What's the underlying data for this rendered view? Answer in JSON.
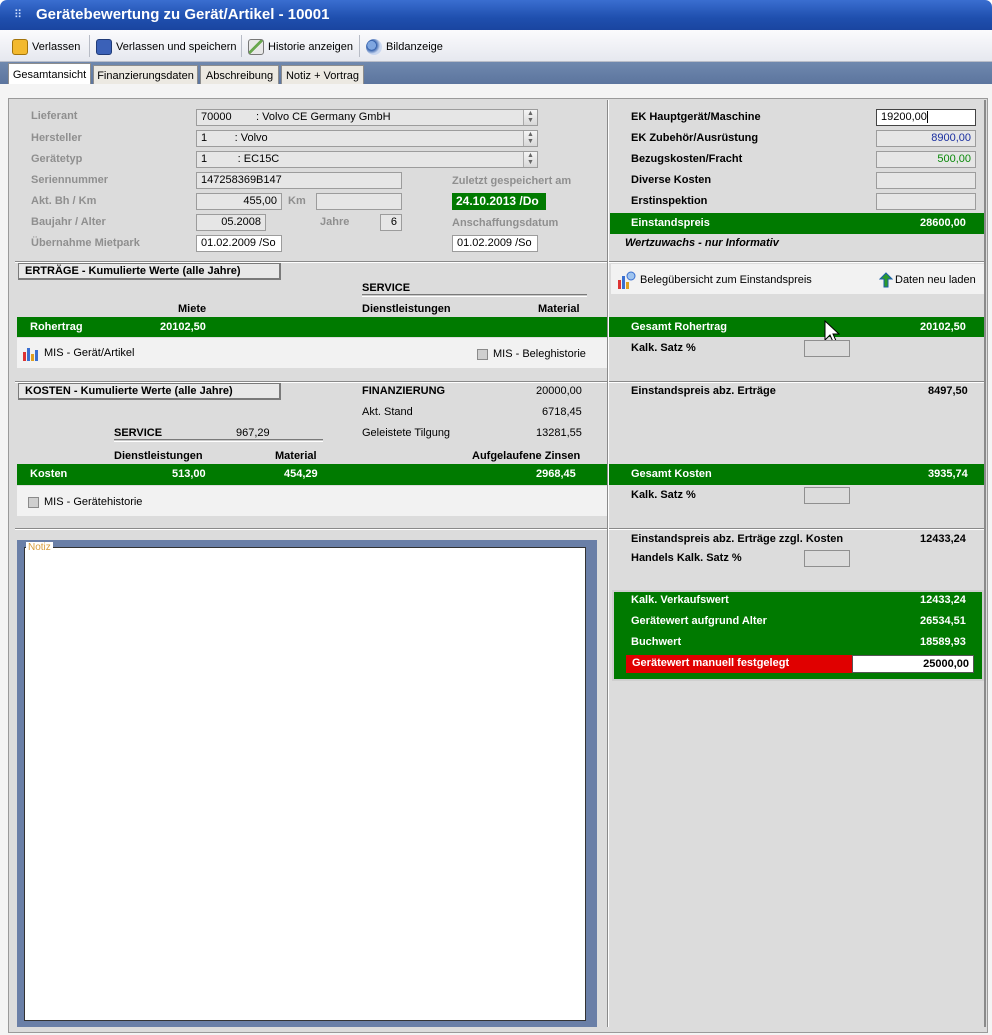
{
  "window": {
    "title": "Gerätebewertung zu Gerät/Artikel - 10001"
  },
  "toolbar": {
    "exit_label": "Verlassen",
    "save_exit_label": "Verlassen und speichern",
    "history_label": "Historie anzeigen",
    "image_label": "Bildanzeige"
  },
  "tabs": [
    {
      "label": "Gesamtansicht",
      "active": true
    },
    {
      "label": "Finanzierungsdaten"
    },
    {
      "label": "Abschreibung"
    },
    {
      "label": "Notiz + Vortrag"
    }
  ],
  "device": {
    "lieferant_label": "Lieferant",
    "lieferant_value": "70000        : Volvo CE Germany GmbH",
    "hersteller_label": "Hersteller",
    "hersteller_value": "1         : Volvo",
    "geraetetyp_label": "Gerätetyp",
    "geraetetyp_value": "1          : EC15C",
    "seriennummer_label": "Seriennummer",
    "seriennummer_value": "147258369B147",
    "bh_km_label": "Akt. Bh / Km",
    "bh_value": "455,00",
    "km_label": "Km",
    "km_value": "",
    "baujahr_label": "Baujahr / Alter",
    "baujahr_value": "05.2008",
    "jahre_label": "Jahre",
    "jahre_value": "6",
    "mietpark_label": "Übernahme Mietpark",
    "mietpark_value": "01.02.2009 /So",
    "saved_label": "Zuletzt gespeichert am",
    "saved_value": "24.10.2013 /Do",
    "anschaffung_label": "Anschaffungsdatum",
    "anschaffung_value": "01.02.2009 /So"
  },
  "ertraege": {
    "header": "ERTRÄGE  - Kumulierte Werte (alle Jahre)",
    "service_label": "SERVICE",
    "miete_label": "Miete",
    "dienst_label": "Dienstleistungen",
    "material_label": "Material",
    "rohertrag_label": "Rohertrag",
    "rohertrag_value": "20102,50",
    "mis_geraet": "MIS - Gerät/Artikel",
    "mis_beleg": "MIS - Beleghistorie"
  },
  "kosten": {
    "header": "KOSTEN  - Kumulierte Werte (alle Jahre)",
    "finanz_label": "FINANZIERUNG",
    "finanz_value": "20000,00",
    "stand_label": "Akt. Stand",
    "stand_value": "6718,45",
    "tilgung_label": "Geleistete Tilgung",
    "tilgung_value": "13281,55",
    "service_label": "SERVICE",
    "service_value": "967,29",
    "dienst_label": "Dienstleistungen",
    "material_label": "Material",
    "zinsen_label": "Aufgelaufene Zinsen",
    "kosten_label": "Kosten",
    "dienst_value": "513,00",
    "material_value": "454,29",
    "zinsen_value": "2968,45",
    "mis_historie": "MIS - Gerätehistorie"
  },
  "notiz": {
    "label": "Notiz",
    "text": ""
  },
  "right": {
    "ek_haupt_label": "EK Hauptgerät/Maschine",
    "ek_haupt_value": "19200,00",
    "ek_zub_label": "EK Zubehör/Ausrüstung",
    "ek_zub_value": "8900,00",
    "bezug_label": "Bezugskosten/Fracht",
    "bezug_value": "500,00",
    "divers_label": "Diverse Kosten",
    "divers_value": "",
    "erstinsp_label": "Erstinspektion",
    "erstinsp_value": "",
    "einstandspreis_label": "Einstandspreis",
    "einstandspreis_value": "28600,00",
    "wertzuwachs_label": "Wertzuwachs - nur Informativ",
    "beleg_label": "Belegübersicht zum Einstandspreis",
    "reload_label": "Daten neu laden",
    "gesamt_roh_label": "Gesamt Rohertrag",
    "gesamt_roh_value": "20102,50",
    "kalk1_label": "Kalk. Satz %",
    "abz_ertr_label": "Einstandspreis abz. Erträge",
    "abz_ertr_value": "8497,50",
    "gesamt_kosten_label": "Gesamt Kosten",
    "gesamt_kosten_value": "3935,74",
    "kalk2_label": "Kalk. Satz %",
    "abz_kosten_label": "Einstandspreis abz. Erträge zzgl. Kosten",
    "abz_kosten_value": "12433,24",
    "handels_label": "Handels Kalk. Satz %",
    "verkauf_label": "Kalk. Verkaufswert",
    "verkauf_value": "12433,24",
    "alter_label": "Gerätewert aufgrund Alter",
    "alter_value": "26534,51",
    "buchwert_label": "Buchwert",
    "buchwert_value": "18589,93",
    "manuell_label": "Gerätewert manuell festgelegt",
    "manuell_value": "25000,00"
  },
  "colors": {
    "green": "#007a00",
    "red": "#e00000",
    "titlebar": "#1f4fae",
    "tabstrip": "#5f7aa3"
  }
}
